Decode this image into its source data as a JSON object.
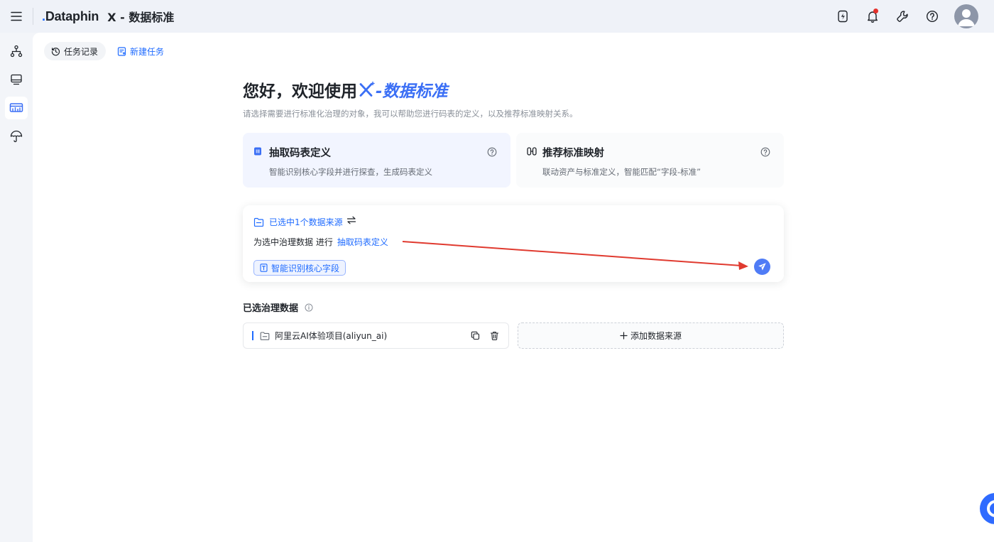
{
  "header": {
    "brand_text": "Dataphin",
    "app_title": "X - 数据标准",
    "icons": [
      "menu-icon",
      "lightning-icon",
      "bell-icon",
      "wrench-icon",
      "help-icon"
    ],
    "notification_dot_color": "#e5322d"
  },
  "sidebar": {
    "items": [
      {
        "icon": "sitemap-icon",
        "active": false
      },
      {
        "icon": "monitor-icon",
        "active": false
      },
      {
        "icon": "data-standard-icon",
        "active": true
      },
      {
        "icon": "umbrella-icon",
        "active": false
      }
    ],
    "active_color": "#3b6ff5"
  },
  "toolbar": {
    "history_label": "任务记录",
    "new_task_label": "新建任务"
  },
  "welcome": {
    "greeting": "您好，欢迎使用",
    "product": "-数据标准",
    "subtitle": "请选择需要进行标准化治理的对象，我可以帮助您进行码表的定义，以及推荐标准映射关系。"
  },
  "modes": [
    {
      "title": "抽取码表定义",
      "desc": "智能识别核心字段并进行探查，生成码表定义",
      "active": true
    },
    {
      "title": "推荐标准映射",
      "desc": "联动资产与标准定义，智能匹配“字段-标准”",
      "active": false
    }
  ],
  "input_card": {
    "source_label": "已选中1个数据来源",
    "line_prefix": "为选中治理数据 进行",
    "line_action": "抽取码表定义",
    "chip_label": "智能识别核心字段"
  },
  "selected_data": {
    "title": "已选治理数据",
    "items": [
      {
        "name": "阿里云AI体验项目(aliyun_ai)"
      }
    ],
    "add_label": "添加数据来源"
  },
  "colors": {
    "accent": "#1f6bff",
    "annotation_arrow": "#e03a2f"
  }
}
